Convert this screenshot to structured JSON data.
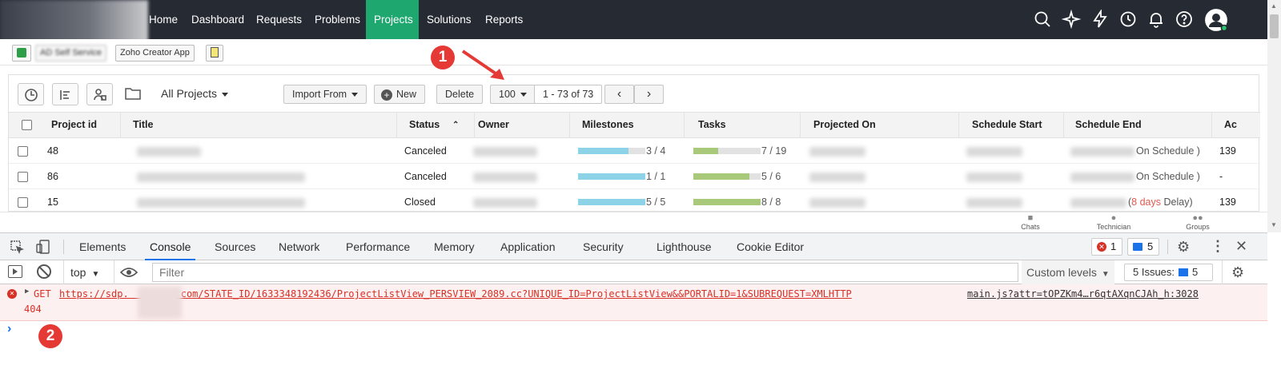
{
  "nav": {
    "items": [
      "Home",
      "Dashboard",
      "Requests",
      "Problems",
      "Projects",
      "Solutions",
      "Reports"
    ],
    "active": "Projects"
  },
  "quickbar": {
    "btn1": "AD Self Service",
    "btn2": "Zoho Creator App"
  },
  "toolbar": {
    "view": "All Projects",
    "import": "Import From",
    "new": "New",
    "delete": "Delete",
    "page_size": "100",
    "range": "1 - 73 of 73"
  },
  "table": {
    "headers": [
      "Project id",
      "Title",
      "Status",
      "Owner",
      "Milestones",
      "Tasks",
      "Projected On",
      "Schedule Start",
      "Schedule End",
      "Ac"
    ],
    "rows": [
      {
        "id": "48",
        "status": "Canceled",
        "milestones": "3 / 4",
        "milestones_ratio": 0.75,
        "tasks": "7 / 19",
        "tasks_ratio": 0.37,
        "end_note": "On Schedule )",
        "extra": "139"
      },
      {
        "id": "86",
        "status": "Canceled",
        "milestones": "1 / 1",
        "milestones_ratio": 1.0,
        "tasks": "5 / 6",
        "tasks_ratio": 0.83,
        "end_note": "On Schedule )",
        "extra": "-"
      },
      {
        "id": "15",
        "status": "Closed",
        "milestones": "5 / 5",
        "milestones_ratio": 1.0,
        "tasks": "8 / 8",
        "tasks_ratio": 1.0,
        "end_note_delay": "8 days",
        "end_note_suffix": " Delay)",
        "extra": "139"
      }
    ]
  },
  "bottom": {
    "chats": "Chats",
    "technician": "Technician",
    "groups": "Groups"
  },
  "devtools": {
    "tabs": [
      "Elements",
      "Console",
      "Sources",
      "Network",
      "Performance",
      "Memory",
      "Application",
      "Security",
      "Lighthouse",
      "Cookie Editor"
    ],
    "active_tab": "Console",
    "error_count": "1",
    "msg_count": "5",
    "context": "top",
    "filter_placeholder": "Filter",
    "levels": "Custom levels",
    "issues_label": "5 Issues:",
    "issues_count": "5",
    "error": {
      "method": "GET",
      "url": "https://sdp.        .com/STATE_ID/1633348192436/ProjectListView_PERSVIEW_2089.cc?UNIQUE_ID=ProjectListView&&PORTALID=1&SUBREQUEST=XMLHTTP",
      "status": "404",
      "source": "main.js?attr=tOPZKm4…r6qtAXqnCJAh_h:3028"
    },
    "prompt": "›"
  },
  "annotations": {
    "one": "1",
    "two": "2"
  },
  "colors": {
    "nav_bg": "#252a33",
    "active_green": "#1fa770",
    "milestone_bar": "#8dd3e8",
    "task_bar": "#a8c97a",
    "error_red": "#d93025",
    "annotation_red": "#e53935"
  }
}
